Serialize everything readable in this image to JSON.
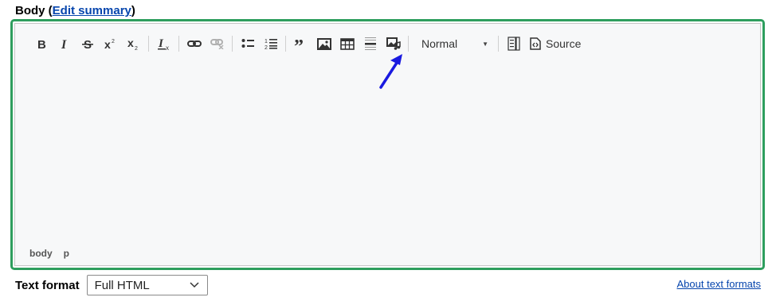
{
  "field": {
    "label": "Body",
    "open_paren": "(",
    "edit_summary_link": "Edit summary",
    "close_paren": ")"
  },
  "toolbar": {
    "buttons": [
      "bold",
      "italic",
      "strikethrough",
      "superscript",
      "subscript",
      "remove-format",
      "link",
      "unlink",
      "bulleted-list",
      "numbered-list",
      "blockquote",
      "image",
      "table",
      "horizontal-line",
      "media-embed"
    ],
    "format_select_value": "Normal",
    "source_label": "Source"
  },
  "path_bar": {
    "items": [
      "body",
      "p"
    ]
  },
  "annotation": {
    "arrow_color": "#1a1ae0"
  },
  "text_format": {
    "label": "Text format",
    "selected": "Full HTML",
    "about_link": "About text formats"
  },
  "colors": {
    "focus_outline": "#2e9e5e",
    "link": "#0645ad"
  }
}
